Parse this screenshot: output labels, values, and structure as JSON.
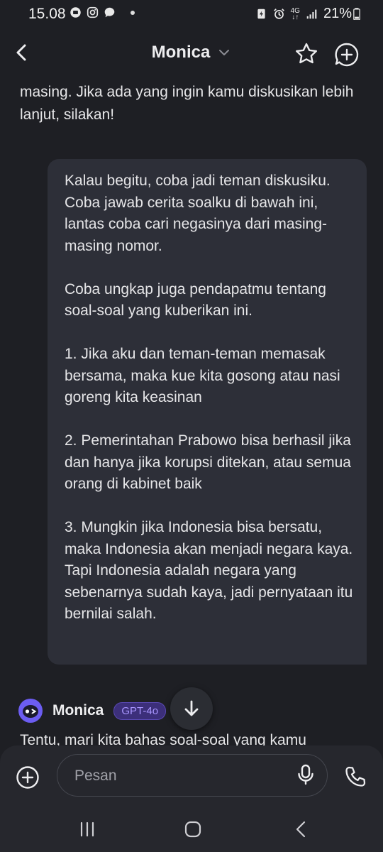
{
  "status": {
    "time": "15.08",
    "battery": "21%",
    "network": "4G"
  },
  "header": {
    "title": "Monica"
  },
  "prev_message": "masing. Jika ada yang ingin kamu diskusikan lebih lanjut, silakan!",
  "user_message": {
    "paragraphs": [
      "Kalau begitu, coba jadi teman diskusiku. Coba jawab cerita soalku di bawah ini, lantas coba cari negasinya dari masing-masing nomor.",
      "Coba ungkap juga pendapatmu tentang soal-soal yang kuberikan ini.",
      "1. Jika aku dan teman-teman memasak bersama, maka kue kita gosong atau nasi goreng kita keasinan",
      "2. Pemerintahan Prabowo bisa berhasil jika dan hanya jika korupsi ditekan, atau semua orang di kabinet baik",
      "3. Mungkin jika Indonesia bisa bersatu, maka Indonesia akan menjadi negara kaya. Tapi Indonesia adalah negara yang sebenarnya sudah kaya, jadi pernyataan itu bernilai salah."
    ]
  },
  "bot": {
    "name": "Monica",
    "model": "GPT-4o",
    "reply_start": "Tentu, mari kita bahas soal-soal yang kamu"
  },
  "composer": {
    "placeholder": "Pesan"
  },
  "colors": {
    "background": "#1e1f24",
    "bubble": "#2d2f38",
    "accent": "#6c5df2",
    "badge_text": "#a996ff"
  }
}
